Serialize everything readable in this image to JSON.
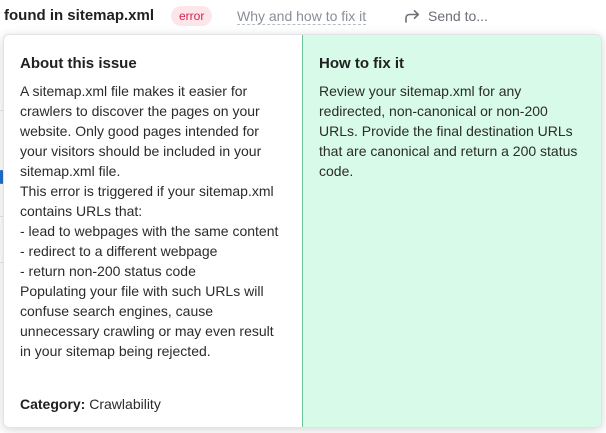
{
  "header": {
    "title": "found in sitemap.xml",
    "badge": "error",
    "fix_link": "Why and how to fix it",
    "send_label": "Send to..."
  },
  "about": {
    "heading": "About this issue",
    "paragraphs": [
      "A sitemap.xml file makes it easier for crawlers to discover the pages on your website. Only good pages intended for your visitors should be included in your sitemap.xml file.",
      "This error is triggered if your sitemap.xml contains URLs that:",
      "- lead to webpages with the same content",
      "- redirect to a different webpage",
      "- return non-200 status code",
      "Populating your file with such URLs will confuse search engines, cause unnecessary crawling or may even result in your sitemap being rejected."
    ],
    "category_label": "Category:",
    "category_value": "Crawlability"
  },
  "fix": {
    "heading": "How to fix it",
    "text": "Review your sitemap.xml for any redirected, non-canonical or non-200 URLs. Provide the final destination URLs that are canonical and return a 200 status code."
  },
  "colors": {
    "badge_bg": "#fde6ea",
    "badge_text": "#d1264a",
    "fix_panel_bg": "#d7fbe8",
    "divider": "#6ec59b"
  },
  "icons": {
    "send": "share-arrow-icon"
  }
}
